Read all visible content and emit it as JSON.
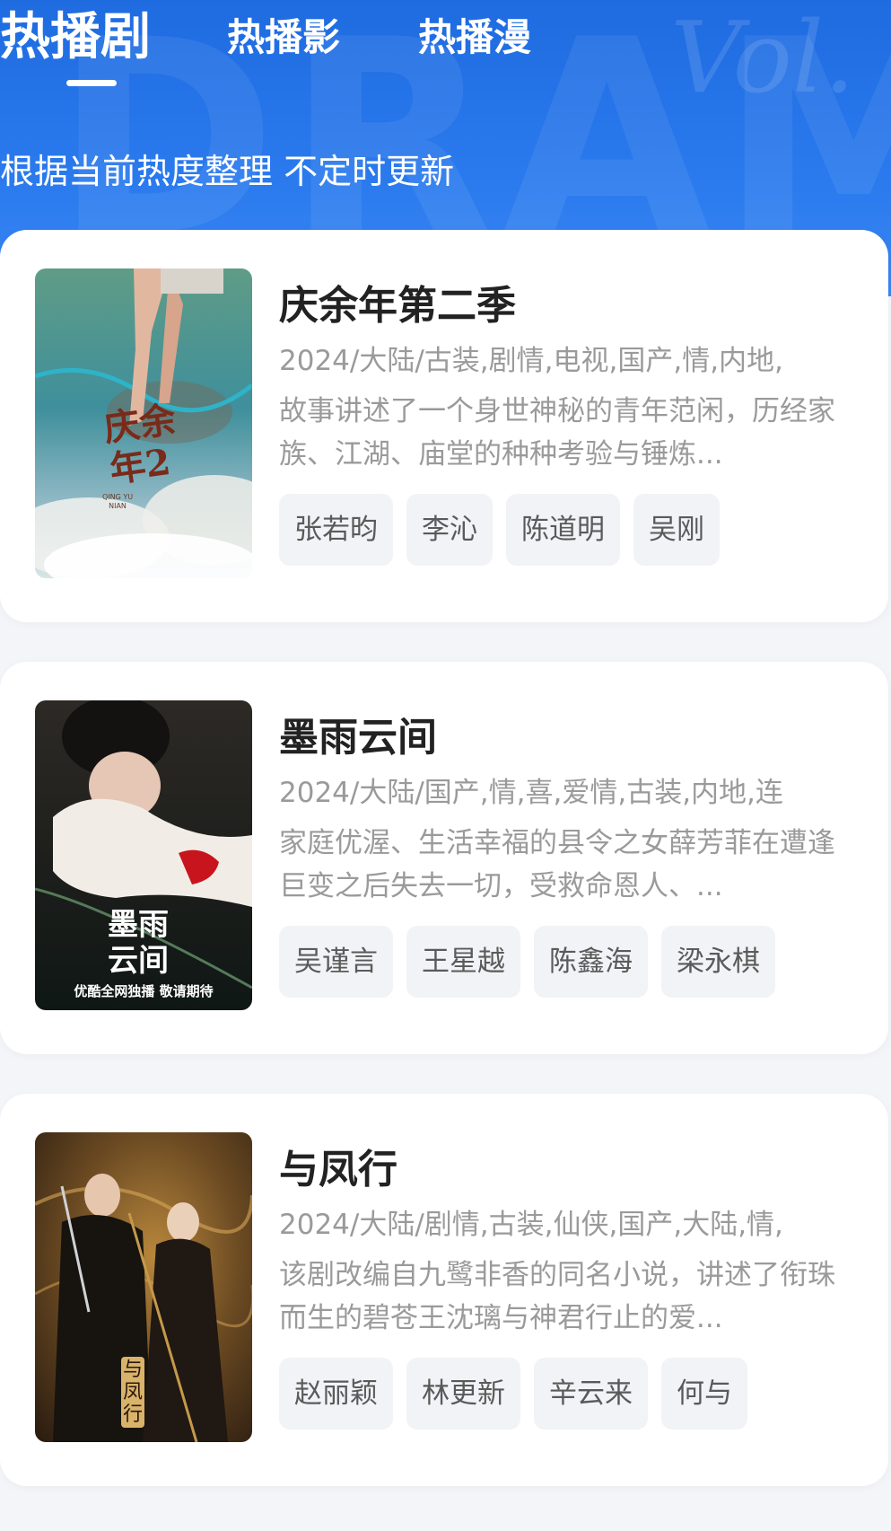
{
  "tabs": [
    {
      "label": "热播剧"
    },
    {
      "label": "热播影"
    },
    {
      "label": "热播漫"
    }
  ],
  "subtitle": "根据当前热度整理 不定时更新",
  "colors": {
    "header_blue": "#2a7aee",
    "card_bg": "#ffffff",
    "chip_bg": "#f2f3f6",
    "text_gray": "#9a9a9a"
  },
  "items": [
    {
      "title": "庆余年第二季",
      "meta": "2024/大陆/古装,剧情,电视,国产,情,内地,",
      "description": "故事讲述了一个身世神秘的青年范闲，历经家族、江湖、庙堂的种种考验与锤炼...",
      "poster_text": "庆余年2",
      "poster_subtext": "QING YU NIAN",
      "cast": [
        "张若昀",
        "李沁",
        "陈道明",
        "吴刚"
      ]
    },
    {
      "title": "墨雨云间",
      "meta": "2024/大陆/国产,情,喜,爱情,古装,内地,连",
      "description": "家庭优渥、生活幸福的县令之女薛芳菲在遭逢巨变之后失去一切，受救命恩人、...",
      "poster_text": "墨雨云间",
      "poster_subtext": "优酷全网独播 敬请期待",
      "cast": [
        "吴谨言",
        "王星越",
        "陈鑫海",
        "梁永棋"
      ]
    },
    {
      "title": "与凤行",
      "meta": "2024/大陆/剧情,古装,仙侠,国产,大陆,情,",
      "description": "该剧改编自九鹭非香的同名小说，讲述了衔珠而生的碧苍王沈璃与神君行止的爱...",
      "poster_text": "与凤行",
      "poster_subtext": "",
      "cast": [
        "赵丽颖",
        "林更新",
        "辛云来",
        "何与"
      ]
    }
  ]
}
